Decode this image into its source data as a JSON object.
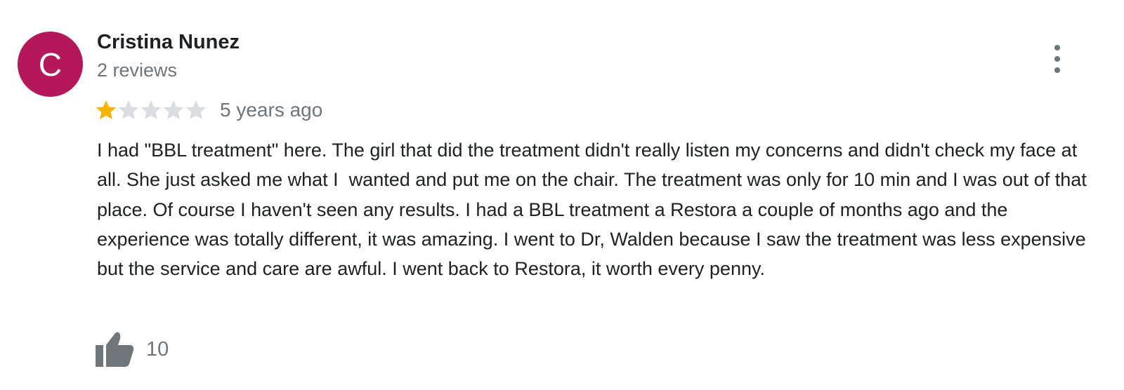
{
  "reviewer": {
    "avatar_letter": "C",
    "avatar_color": "#b5175b",
    "name": "Cristina Nunez",
    "review_count": "2 reviews"
  },
  "review": {
    "rating": 1,
    "max_rating": 5,
    "star_filled_color": "#f4b400",
    "star_empty_color": "#dadce0",
    "time": "5 years ago",
    "text": "I had \"BBL treatment\" here. The girl that did the treatment didn't really listen my concerns and didn't check my face at all. She just asked me what I  wanted and put me on the chair. The treatment was only for 10 min and I was out of that place. Of course I haven't seen any results. I had a BBL treatment a Restora a couple of months ago and the experience was totally different, it was amazing. I went to Dr, Walden because I saw the treatment was less expensive but the service and care are awful. I went back to Restora, it worth every penny."
  },
  "actions": {
    "more_icon": "more-vert-icon",
    "like_icon": "thumb-up-icon",
    "like_count": "10"
  }
}
